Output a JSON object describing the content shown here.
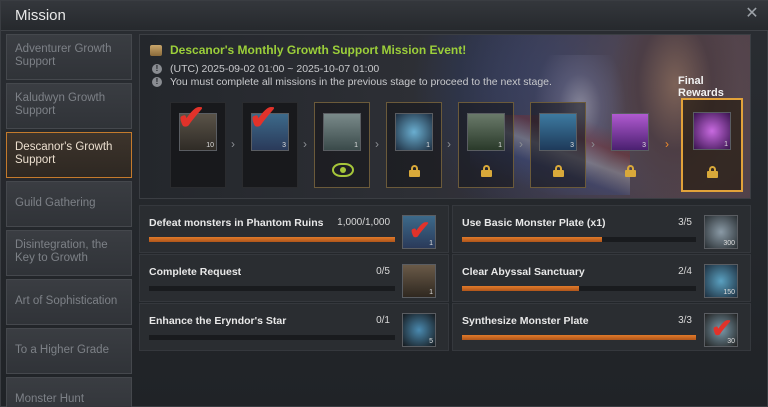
{
  "window": {
    "title": "Mission",
    "close_label": "✕"
  },
  "sidebar": {
    "items": [
      {
        "label": "Adventurer Growth Support",
        "active": false
      },
      {
        "label": "Kaludwyn Growth Support",
        "active": false
      },
      {
        "label": "Descanor's Growth Support",
        "active": true
      },
      {
        "label": "Guild Gathering",
        "active": false
      },
      {
        "label": "Disintegration, the Key to Growth",
        "active": false
      },
      {
        "label": "Art of Sophistication",
        "active": false
      },
      {
        "label": "To a Higher Grade",
        "active": false
      },
      {
        "label": "Monster Hunt",
        "active": false
      }
    ]
  },
  "event": {
    "title": "Descanor's Monthly Growth Support Mission Event!",
    "period": "(UTC) 2025-09-02 01:00 ~ 2025-10-07 01:00",
    "note": "You must complete all missions in the previous stage to proceed to the next stage.",
    "final_rewards_label": "Final Rewards",
    "accent_color": "#9ccf3a"
  },
  "stages": [
    {
      "reward": "chest-icon",
      "count": "10",
      "state": "completed"
    },
    {
      "reward": "monster-plate-icon",
      "count": "3",
      "state": "completed"
    },
    {
      "reward": "chest-icon",
      "count": "1",
      "state": "current"
    },
    {
      "reward": "crystal-icon",
      "count": "1",
      "state": "locked"
    },
    {
      "reward": "chest-icon",
      "count": "1",
      "state": "locked"
    },
    {
      "reward": "monster-plate-icon",
      "count": "3",
      "state": "locked"
    },
    {
      "reward": "purple-chest-icon",
      "count": "3",
      "state": "locked"
    },
    {
      "reward": "purple-crystal-icon",
      "count": "1",
      "state": "locked-final"
    }
  ],
  "missions": [
    {
      "label": "Defeat monsters in Phantom Ruins",
      "progress": "1,000/1,000",
      "fraction": 1.0,
      "reward_count": "1",
      "reward_icon": "monster-plate-icon",
      "done": true
    },
    {
      "label": "Use Basic Monster Plate (x1)",
      "progress": "3/5",
      "fraction": 0.6,
      "reward_count": "300",
      "reward_icon": "ore-icon",
      "done": false
    },
    {
      "label": "Complete Request",
      "progress": "0/5",
      "fraction": 0.0,
      "reward_count": "1",
      "reward_icon": "chest-icon",
      "done": false
    },
    {
      "label": "Clear Abyssal Sanctuary",
      "progress": "2/4",
      "fraction": 0.5,
      "reward_count": "150",
      "reward_icon": "crystal-icon",
      "done": false
    },
    {
      "label": "Enhance the Eryndor's Star",
      "progress": "0/1",
      "fraction": 0.0,
      "reward_count": "5",
      "reward_icon": "orb-icon",
      "done": false
    },
    {
      "label": "Synthesize Monster Plate",
      "progress": "3/3",
      "fraction": 1.0,
      "reward_count": "30",
      "reward_icon": "crystal-icon",
      "done": true
    }
  ],
  "colors": {
    "progress_fill": "#e07a2a",
    "active_border": "#c47a2c",
    "check": "#e2322a",
    "lock": "#d9a93a"
  }
}
